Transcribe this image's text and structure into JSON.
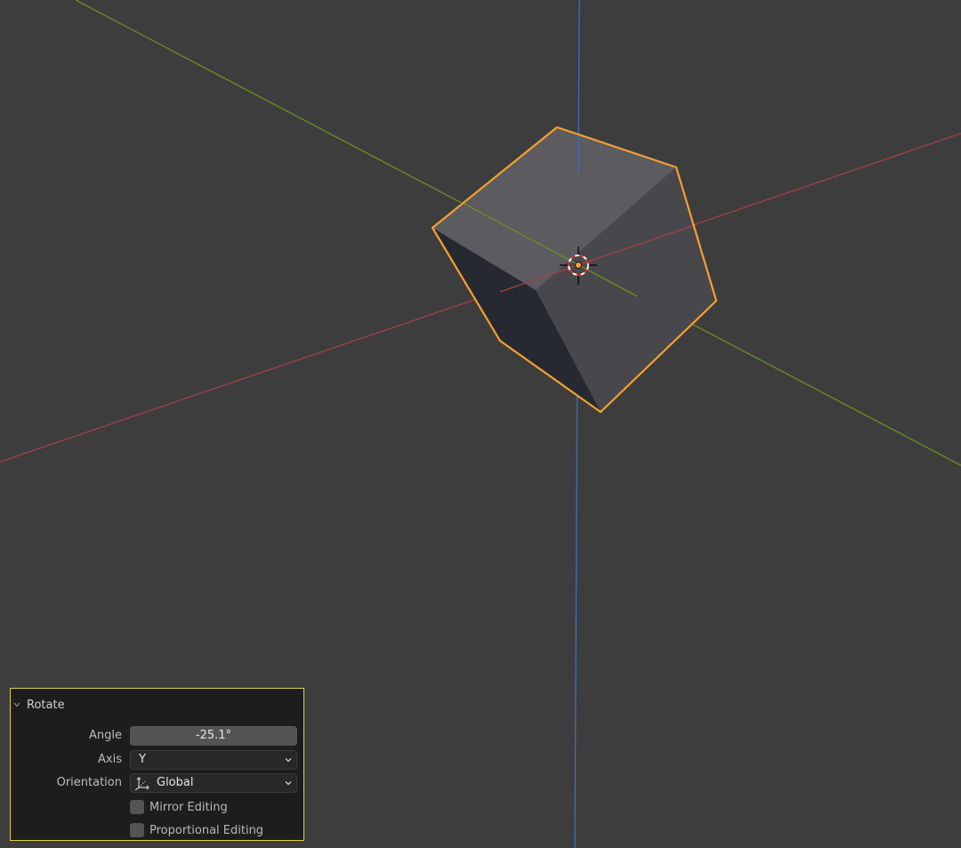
{
  "viewport": {
    "background": "#3d3d3d",
    "axis_colors": {
      "x": "#a5404a",
      "y": "#6b8e23",
      "z": "#3f6dc2"
    },
    "selection_outline": "#f5a030",
    "cube_face_colors": {
      "top": "#5c5b60",
      "right": "#48474b",
      "left": "#262930"
    }
  },
  "operator_panel": {
    "title": "Rotate",
    "collapse_icon": "chevron-down-icon",
    "angle": {
      "label": "Angle",
      "value": "-25.1°"
    },
    "axis": {
      "label": "Axis",
      "value": "Y"
    },
    "orientation": {
      "label": "Orientation",
      "value": "Global",
      "icon": "global-orientation-icon"
    },
    "mirror_editing": {
      "label": "Mirror Editing",
      "checked": false
    },
    "proportional_editing": {
      "label": "Proportional Editing",
      "checked": false
    }
  }
}
